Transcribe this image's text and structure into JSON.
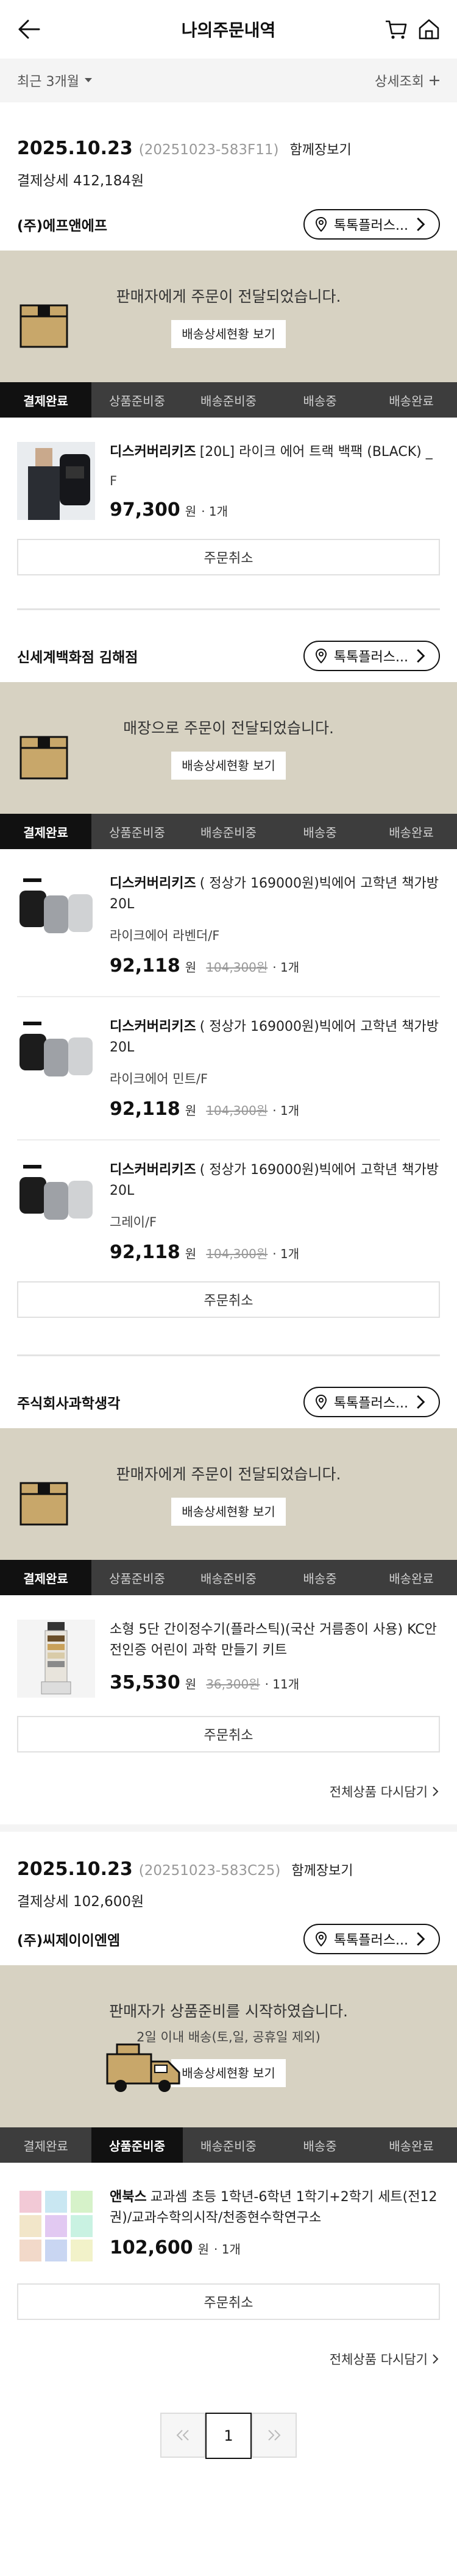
{
  "header": {
    "title": "나의주문내역"
  },
  "filter": {
    "period": "최근 3개월",
    "detail_search": "상세조회"
  },
  "orders": [
    {
      "date": "2025.10.23",
      "order_no": "(20251023-583F11)",
      "detail_link": "함께장보기",
      "summary": "결제상세 412,184원",
      "groups": [
        {
          "seller": "(주)에프앤에프",
          "talk": "톡톡플러스...",
          "status": "판매자에게 주문이 전달되었습니다.",
          "status_sub": "",
          "track_btn": "배송상세현황 보기",
          "steps": [
            "결제완료",
            "상품준비중",
            "배송준비중",
            "배송중",
            "배송완료"
          ],
          "items": [
            {
              "brand": "디스커버리키즈",
              "name": "[20L] 라이크 에어 트랙 백팩 (BLACK) _",
              "option": "F",
              "price": "97,300",
              "won": "원",
              "orig": "",
              "qty": "· 1개"
            }
          ],
          "cancel": "주문취소"
        },
        {
          "seller": "신세계백화점 김해점",
          "talk": "톡톡플러스...",
          "status": "매장으로 주문이 전달되었습니다.",
          "status_sub": "",
          "track_btn": "배송상세현황 보기",
          "steps": [
            "결제완료",
            "상품준비중",
            "배송준비중",
            "배송중",
            "배송완료"
          ],
          "items": [
            {
              "brand": "디스커버리키즈",
              "name": "( 정상가 169000원)빅에어 고학년 책가방 20L",
              "option": "라이크에어 라벤더/F",
              "price": "92,118",
              "won": "원",
              "orig": "104,300원",
              "qty": "· 1개"
            },
            {
              "brand": "디스커버리키즈",
              "name": "( 정상가 169000원)빅에어 고학년 책가방 20L",
              "option": "라이크에어 민트/F",
              "price": "92,118",
              "won": "원",
              "orig": "104,300원",
              "qty": "· 1개"
            },
            {
              "brand": "디스커버리키즈",
              "name": "( 정상가 169000원)빅에어 고학년 책가방 20L",
              "option": "그레이/F",
              "price": "92,118",
              "won": "원",
              "orig": "104,300원",
              "qty": "· 1개"
            }
          ],
          "cancel": "주문취소"
        },
        {
          "seller": "주식회사과학생각",
          "talk": "톡톡플러스...",
          "status": "판매자에게 주문이 전달되었습니다.",
          "status_sub": "",
          "track_btn": "배송상세현황 보기",
          "steps": [
            "결제완료",
            "상품준비중",
            "배송준비중",
            "배송중",
            "배송완료"
          ],
          "items": [
            {
              "brand": "",
              "name": "소형 5단 간이정수기(플라스틱)(국산 거름종이 사용) KC안전인증 어린이 과학 만들기 키트",
              "option": "",
              "price": "35,530",
              "won": "원",
              "orig": "36,300원",
              "qty": "· 11개"
            }
          ],
          "cancel": "주문취소",
          "rebuy": "전체상품 다시담기"
        }
      ]
    },
    {
      "date": "2025.10.23",
      "order_no": "(20251023-583C25)",
      "detail_link": "함께장보기",
      "summary": "결제상세 102,600원",
      "groups": [
        {
          "seller": "(주)씨제이이엔엠",
          "talk": "톡톡플러스...",
          "status": "판매자가 상품준비를 시작하였습니다.",
          "status_sub": "2일 이내 배송(토,일, 공휴일 제외)",
          "track_btn": "배송상세현황 보기",
          "steps": [
            "결제완료",
            "상품준비중",
            "배송준비중",
            "배송중",
            "배송완료"
          ],
          "items": [
            {
              "brand": "앤북스",
              "name": "교과셈 초등 1학년-6학년 1학기+2학기 세트(전12권)/교과수학의시작/천종현수학연구소",
              "option": "",
              "price": "102,600",
              "won": "원",
              "orig": "",
              "qty": "· 1개"
            }
          ],
          "cancel": "주문취소",
          "rebuy": "전체상품 다시담기"
        }
      ]
    }
  ],
  "pagination": {
    "current": "1"
  }
}
